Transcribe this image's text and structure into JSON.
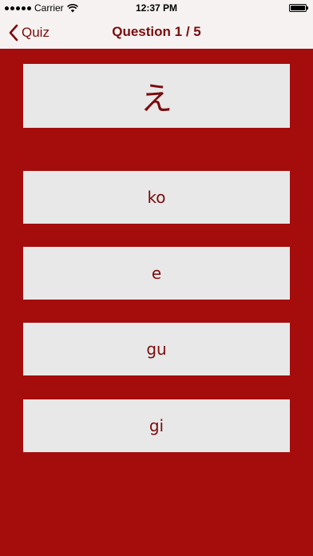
{
  "status_bar": {
    "carrier": "Carrier",
    "time": "12:37 PM",
    "wifi_icon": "wifi-icon",
    "battery_icon": "battery-icon"
  },
  "nav": {
    "back_label": "Quiz",
    "back_icon": "chevron-left-icon",
    "title": "Question 1 / 5"
  },
  "question": {
    "character": "え"
  },
  "answers": [
    {
      "label": "ko"
    },
    {
      "label": "e"
    },
    {
      "label": "gu"
    },
    {
      "label": "gi"
    }
  ],
  "colors": {
    "background": "#A50D0D",
    "accent": "#7A0C0C",
    "card": "#E8E8E8",
    "bar": "#F7F2F2"
  }
}
